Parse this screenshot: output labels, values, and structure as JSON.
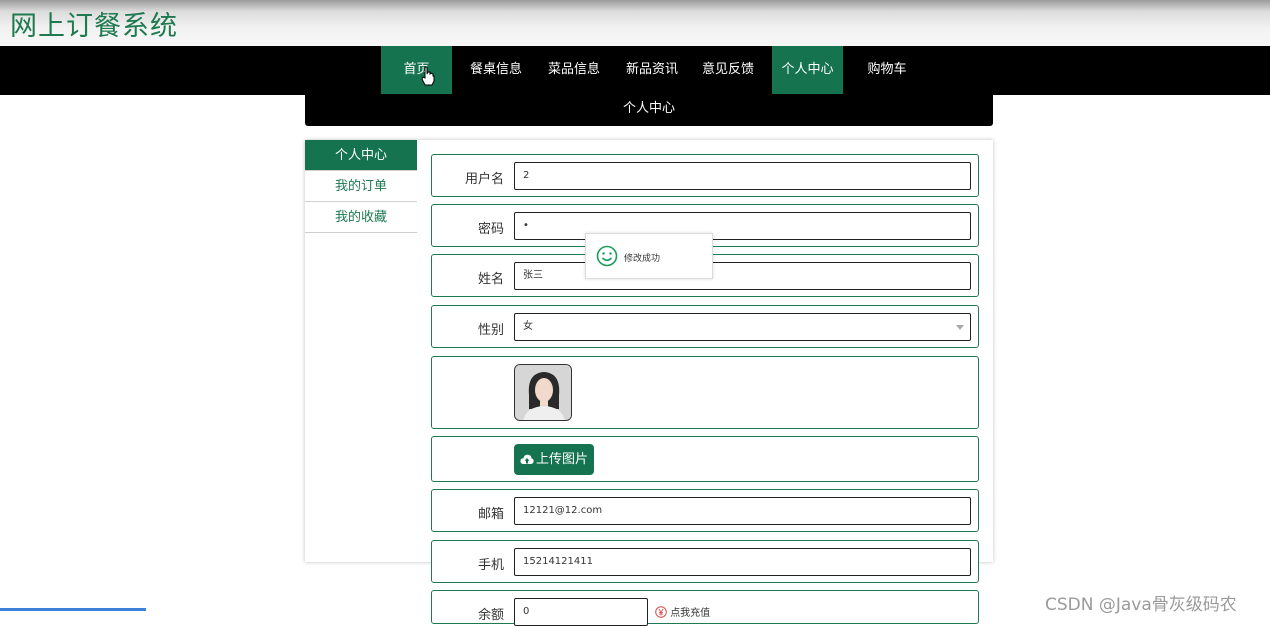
{
  "app": {
    "title": "网上订餐系统"
  },
  "nav": {
    "items": [
      {
        "label": "首页"
      },
      {
        "label": "餐桌信息"
      },
      {
        "label": "菜品信息"
      },
      {
        "label": "新品资讯"
      },
      {
        "label": "意见反馈"
      },
      {
        "label": "个人中心"
      },
      {
        "label": "购物车"
      }
    ],
    "active_index": 5
  },
  "section": {
    "title": "个人中心"
  },
  "sidebar": {
    "items": [
      {
        "label": "个人中心"
      },
      {
        "label": "我的订单"
      },
      {
        "label": "我的收藏"
      }
    ],
    "active_index": 0
  },
  "form": {
    "username": {
      "label": "用户名",
      "value": "2"
    },
    "password": {
      "label": "密码",
      "value": "•"
    },
    "name": {
      "label": "姓名",
      "value": "张三"
    },
    "gender": {
      "label": "性别",
      "value": "女"
    },
    "upload": {
      "label": "上传图片"
    },
    "email": {
      "label": "邮箱",
      "value": "12121@12.com"
    },
    "phone": {
      "label": "手机",
      "value": "15214121411"
    },
    "balance": {
      "label": "余额",
      "value": "0",
      "recharge_label": "点我充值"
    }
  },
  "toast": {
    "message": "修改成功"
  },
  "watermark": {
    "text": "CSDN @Java骨灰级码农"
  },
  "colors": {
    "accent": "#15744f",
    "nav_bg": "#000000",
    "title_green": "#1f7a4f"
  }
}
